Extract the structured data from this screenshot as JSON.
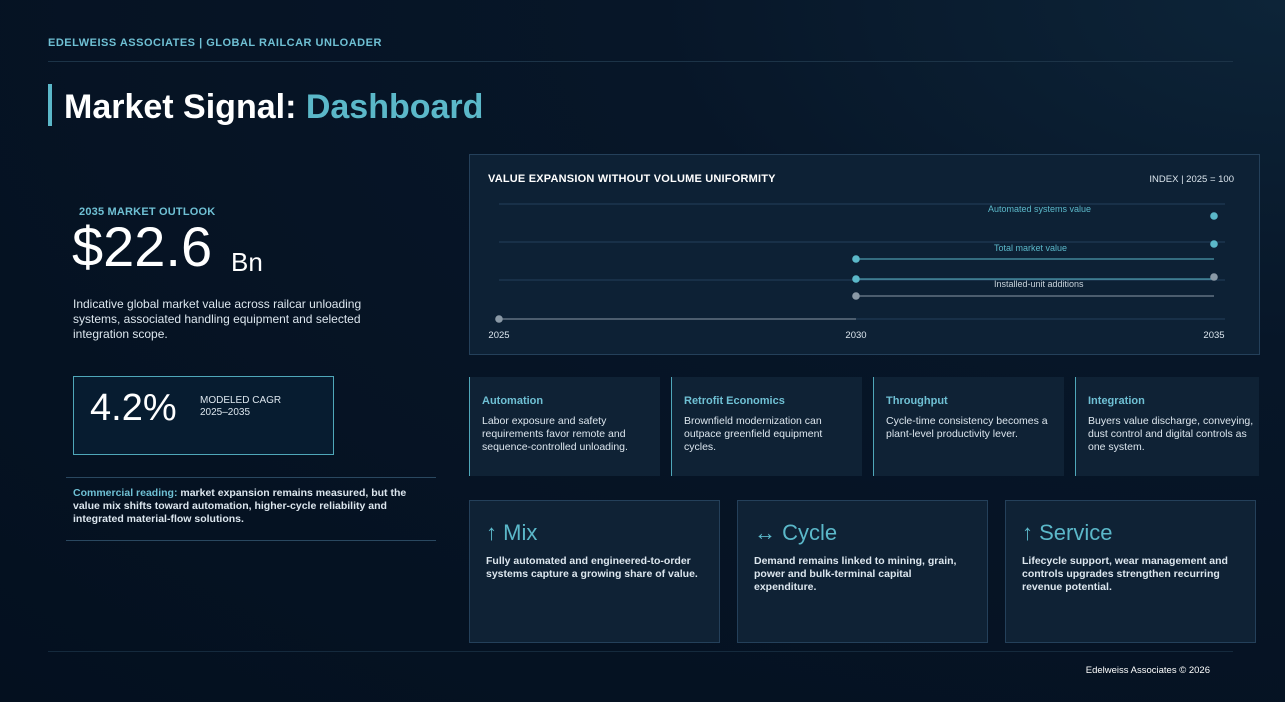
{
  "header": {
    "brand": "EDELWEISS ASSOCIATES | GLOBAL RAILCAR UNLOADER",
    "title_main": "Market Signal: ",
    "title_accent": "Dashboard"
  },
  "outlook": {
    "label": "2035 MARKET OUTLOOK",
    "value": "$22.6",
    "unit": "Bn",
    "description": "Indicative global market value across railcar unloading systems, associated handling equipment and selected integration scope."
  },
  "cagr": {
    "value": "4.2%",
    "label_line1": "MODELED CAGR",
    "label_line2": "2025–2035"
  },
  "commercial_reading": {
    "lead": "Commercial reading:",
    "text": " market expansion remains measured, but the value mix shifts toward automation, higher-cycle reliability and integrated material-flow solutions."
  },
  "chart_data": {
    "type": "line",
    "title": "VALUE EXPANSION WITHOUT VOLUME UNIFORMITY",
    "index_note": "INDEX | 2025 = 100",
    "x": [
      "2025",
      "2030",
      "2035"
    ],
    "series": [
      {
        "name": "Automated systems value",
        "color": "#5bb8c9"
      },
      {
        "name": "Total market value",
        "color": "#5bb8c9"
      },
      {
        "name": "Installed-unit additions",
        "color": "#8a99a6"
      }
    ]
  },
  "drivers": [
    {
      "title": "Automation",
      "text": "Labor exposure and safety requirements favor remote and sequence-controlled unloading."
    },
    {
      "title": "Retrofit Economics",
      "text": "Brownfield modernization can outpace greenfield equipment cycles."
    },
    {
      "title": "Throughput",
      "text": "Cycle-time consistency becomes a plant-level productivity lever."
    },
    {
      "title": "Integration",
      "text": "Buyers value discharge, conveying, dust control and digital controls as one system."
    }
  ],
  "cards": [
    {
      "head": "↑ Mix",
      "text": "Fully automated and engineered-to-order systems capture a growing share of value."
    },
    {
      "head": "↔ Cycle",
      "text": "Demand remains linked to mining, grain, power and bulk-terminal capital expenditure."
    },
    {
      "head": "↑ Service",
      "text": "Lifecycle support, wear management and controls upgrades strengthen recurring revenue potential."
    }
  ],
  "footer": {
    "text": "Edelweiss Associates © 2026"
  },
  "colors": {
    "accent": "#5bb8c9",
    "background": "#04101f",
    "panel": "#0f2235"
  }
}
